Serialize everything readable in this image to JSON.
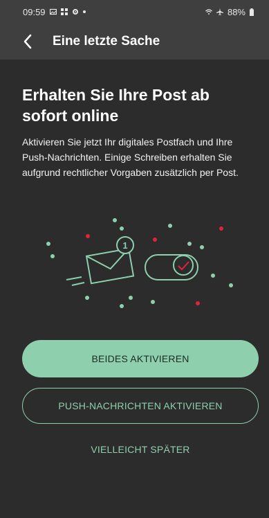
{
  "status_bar": {
    "time": "09:59",
    "battery": "88%",
    "icons": [
      "image-icon",
      "grid-icon",
      "gear-icon",
      "dot-icon",
      "wifi-icon",
      "airplane-icon",
      "battery-icon"
    ]
  },
  "app_bar": {
    "back_icon": "chevron-left-icon",
    "title": "Eine letzte Sache"
  },
  "main": {
    "headline": "Erhalten Sie Ihre Post ab sofort online",
    "body": "Aktivieren Sie jetzt Ihr digitales Postfach und Ihre Push-Nachrichten. Einige Schreiben erhalten Sie aufgrund rechtlicher Vorgaben zusätzlich per Post.",
    "illustration": {
      "icons": [
        "envelope-icon",
        "toggle-switch-icon"
      ],
      "badge_count": "1"
    }
  },
  "actions": {
    "primary_label": "BEIDES AKTIVIEREN",
    "secondary_label": "PUSH-NACHRICHTEN AKTIVIEREN",
    "tertiary_label": "VIELLEICHT SPÄTER"
  },
  "colors": {
    "background": "#2c2c2c",
    "app_bar": "#3f3f3f",
    "accent": "#8ed0ae",
    "confetti_red": "#e0243c"
  }
}
